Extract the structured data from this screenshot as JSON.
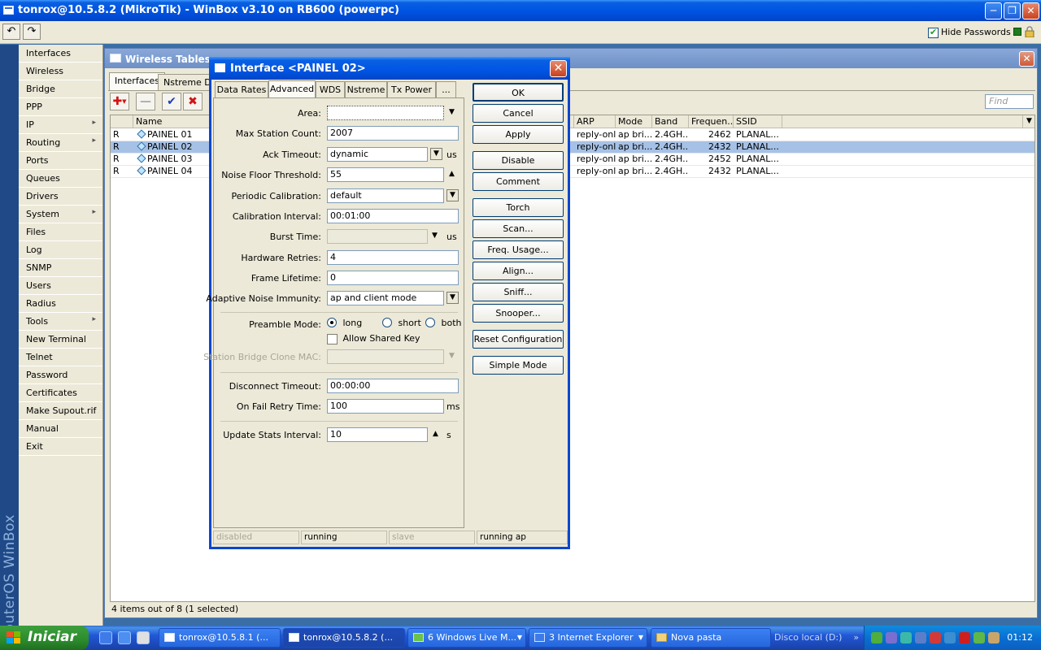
{
  "window": {
    "title": "tonrox@10.5.8.2 (MikroTik) - WinBox v3.10 on RB600 (powerpc)",
    "undo_icon": "undo-icon",
    "redo_icon": "redo-icon",
    "hide_passwords_label": "Hide Passwords",
    "hide_passwords_checked": true
  },
  "brand": "RouterOS WinBox",
  "sidebar": {
    "items": [
      {
        "label": "Interfaces"
      },
      {
        "label": "Wireless"
      },
      {
        "label": "Bridge"
      },
      {
        "label": "PPP"
      },
      {
        "label": "IP",
        "submenu": true
      },
      {
        "label": "Routing",
        "submenu": true
      },
      {
        "label": "Ports"
      },
      {
        "label": "Queues"
      },
      {
        "label": "Drivers"
      },
      {
        "label": "System",
        "submenu": true
      },
      {
        "label": "Files"
      },
      {
        "label": "Log"
      },
      {
        "label": "SNMP"
      },
      {
        "label": "Users"
      },
      {
        "label": "Radius"
      },
      {
        "label": "Tools",
        "submenu": true
      },
      {
        "label": "New Terminal"
      },
      {
        "label": "Telnet"
      },
      {
        "label": "Password"
      },
      {
        "label": "Certificates"
      },
      {
        "label": "Make Supout.rif"
      },
      {
        "label": "Manual"
      },
      {
        "label": "Exit"
      }
    ]
  },
  "wireless_tables": {
    "title": "Wireless Tables",
    "tabs": [
      "Interfaces",
      "Nstreme Dual"
    ],
    "find_placeholder": "Find",
    "columns": {
      "flag": "",
      "name": "Name",
      "arp": "ARP",
      "mode": "Mode",
      "band": "Band",
      "frequency": "Frequen...",
      "ssid": "SSID"
    },
    "rows": [
      {
        "flag": "R",
        "name": "PAINEL 01",
        "arp": "reply-only",
        "mode": "ap bri...",
        "band": "2.4GH...",
        "frequency": "2462",
        "ssid": "PLANAL...",
        "selected": false
      },
      {
        "flag": "R",
        "name": "PAINEL 02",
        "arp": "reply-only",
        "mode": "ap bri...",
        "band": "2.4GH...",
        "frequency": "2432",
        "ssid": "PLANAL...",
        "selected": true
      },
      {
        "flag": "R",
        "name": "PAINEL 03",
        "arp": "reply-only",
        "mode": "ap bri...",
        "band": "2.4GH...",
        "frequency": "2452",
        "ssid": "PLANAL...",
        "selected": false
      },
      {
        "flag": "R",
        "name": "PAINEL 04",
        "arp": "reply-only",
        "mode": "ap bri...",
        "band": "2.4GH...",
        "frequency": "2432",
        "ssid": "PLANAL...",
        "selected": false
      }
    ],
    "status": "4 items out of 8 (1 selected)"
  },
  "dialog": {
    "title": "Interface <PAINEL 02>",
    "tabs": [
      "Data Rates",
      "Advanced",
      "WDS",
      "Nstreme",
      "Tx Power",
      "..."
    ],
    "active_tab": "Advanced",
    "fields": {
      "area": {
        "label": "Area:",
        "value": ""
      },
      "max_station_count": {
        "label": "Max Station Count:",
        "value": "2007"
      },
      "ack_timeout": {
        "label": "Ack Timeout:",
        "value": "dynamic",
        "unit": "us"
      },
      "noise_floor_threshold": {
        "label": "Noise Floor Threshold:",
        "value": "55"
      },
      "periodic_calibration": {
        "label": "Periodic Calibration:",
        "value": "default"
      },
      "calibration_interval": {
        "label": "Calibration Interval:",
        "value": "00:01:00"
      },
      "burst_time": {
        "label": "Burst Time:",
        "value": "",
        "unit": "us"
      },
      "hardware_retries": {
        "label": "Hardware Retries:",
        "value": "4"
      },
      "frame_lifetime": {
        "label": "Frame Lifetime:",
        "value": "0"
      },
      "adaptive_noise_immunity": {
        "label": "Adaptive Noise Immunity:",
        "value": "ap and client mode"
      },
      "preamble_mode": {
        "label": "Preamble Mode:",
        "options": [
          "long",
          "short",
          "both"
        ],
        "selected": "long"
      },
      "allow_shared_key": {
        "label": "Allow Shared Key",
        "checked": false
      },
      "station_bridge_clone_mac": {
        "label": "Station Bridge Clone MAC:",
        "value": ""
      },
      "disconnect_timeout": {
        "label": "Disconnect Timeout:",
        "value": "00:00:00"
      },
      "on_fail_retry_time": {
        "label": "On Fail Retry Time:",
        "value": "100",
        "unit": "ms"
      },
      "update_stats_interval": {
        "label": "Update Stats Interval:",
        "value": "10",
        "unit": "s"
      }
    },
    "buttons": {
      "ok": "OK",
      "cancel": "Cancel",
      "apply": "Apply",
      "disable": "Disable",
      "comment": "Comment",
      "torch": "Torch",
      "scan": "Scan...",
      "freq_usage": "Freq. Usage...",
      "align": "Align...",
      "sniff": "Sniff...",
      "snooper": "Snooper...",
      "reset_configuration": "Reset Configuration",
      "simple_mode": "Simple Mode"
    },
    "status_bar": [
      "disabled",
      "running",
      "slave",
      "running ap"
    ]
  },
  "taskbar": {
    "start_label": "Iniciar",
    "tasks": [
      {
        "label": "tonrox@10.5.8.1 (...",
        "active": false
      },
      {
        "label": "tonrox@10.5.8.2 (...",
        "active": true
      },
      {
        "label": "6 Windows Live M...",
        "active": false
      },
      {
        "label": "3 Internet Explorer",
        "active": false
      },
      {
        "label": "Nova pasta",
        "active": false
      }
    ],
    "disk_label": "Disco local (D:)",
    "clock": "01:12"
  },
  "colors": {
    "selection": "#a6c1e6",
    "xp_blue": "#0054e3",
    "winbox_brand": "#1f4a87"
  }
}
